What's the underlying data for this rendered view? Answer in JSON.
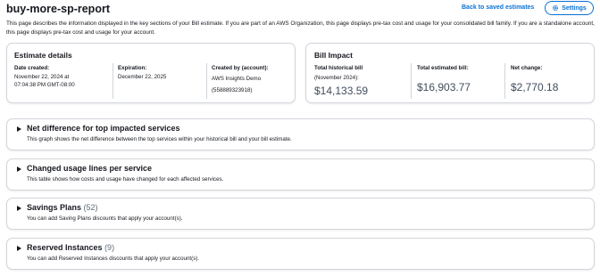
{
  "header": {
    "title": "buy-more-sp-report",
    "back_link": "Back to saved estimates",
    "settings_label": "Settings"
  },
  "description": "This page describes the information displayed in the key sections of your Bill estimate. If you are part of an AWS Organization, this page displays pre-tax cost and usage for your consolidated bill family. If you are a standalone account, this page displays pre-tax cost and usage for your account.",
  "estimate_details": {
    "title": "Estimate details",
    "date_created_label": "Date created:",
    "date_created_line1": "November 22, 2024 at",
    "date_created_line2": "07:04:38 PM GMT-08:00",
    "expiration_label": "Expiration:",
    "expiration_value": "December 22, 2025",
    "created_by_label": "Created by (account):",
    "created_by_name": "AWS Insights Demo",
    "created_by_id": "(558889323918)"
  },
  "bill_impact": {
    "title": "Bill Impact",
    "historical_label": "Total historical bill",
    "historical_period": "(November 2024):",
    "historical_value": "$14,133.59",
    "estimated_label": "Total estimated bill:",
    "estimated_value": "$16,903.77",
    "net_label": "Net change:",
    "net_value": "$2,770.18"
  },
  "sections": [
    {
      "title": "Net difference for top impacted services",
      "count": "",
      "description": "This graph shows the net difference between the top services within your historical bill and your bill estimate."
    },
    {
      "title": "Changed usage lines per service",
      "count": "",
      "description": "This table shows how costs and usage have changed for each affected services."
    },
    {
      "title": "Savings Plans",
      "count": "(52)",
      "description": "You can add Saving Plans discounts that apply your account(s)."
    },
    {
      "title": "Reserved Instances",
      "count": "(9)",
      "description": "You can add Reserved Instances discounts that apply your account(s)."
    }
  ]
}
